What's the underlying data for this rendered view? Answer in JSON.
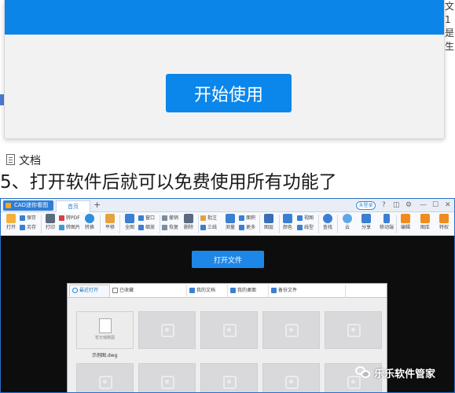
{
  "background": {
    "right_edge_text": [
      "文",
      "1",
      "是",
      "生"
    ],
    "doc_label": "文档"
  },
  "dialog": {
    "start_button": "开始使用",
    "colors": {
      "header": "#0c85e9",
      "button": "#0b86ea",
      "body": "#f2f2f2"
    }
  },
  "step_heading": "5、打开软件后就可以免费使用所有功能了",
  "app": {
    "logo_title": "CAD迷你看图",
    "tab_home": "首页",
    "tab_add": "+",
    "login": "未登录",
    "window_icons": [
      "help-icon",
      "skin-icon",
      "settings-icon",
      "minimize-icon",
      "maximize-icon",
      "close-icon"
    ],
    "ribbon": {
      "open": "打开",
      "save": "保存",
      "save_as": "另存",
      "print": "打印",
      "to_pdf": "转PDF",
      "to_image": "转图片",
      "rotate": "转换",
      "pan": "平移",
      "full_view": "全图",
      "window": "窗口",
      "zoom": "缩放",
      "undo": "撤销",
      "redo": "恢复",
      "delete": "删除",
      "annotate": "批注",
      "three_line": "三线",
      "measure": "测量",
      "area": "面积",
      "more": "更多",
      "layer": "图层",
      "color": "颜色",
      "view": "视图",
      "line_type": "线型",
      "find": "查找",
      "cloud": "云",
      "share": "分享",
      "mobile": "移动端",
      "edit": "编辑",
      "gallery": "图库",
      "special": "特权"
    },
    "open_file_button": "打开文件",
    "file_panel": {
      "tabs": [
        "最近打开",
        "已收藏",
        "我的文档",
        "我的桌面",
        "备份文件"
      ],
      "first_thumb_caption": "暂无缩略图",
      "first_file_name": "示例图.dwg",
      "thumb_count_row1": 5,
      "thumb_count_row2": 5
    }
  },
  "watermark": "乐乐软件管家"
}
